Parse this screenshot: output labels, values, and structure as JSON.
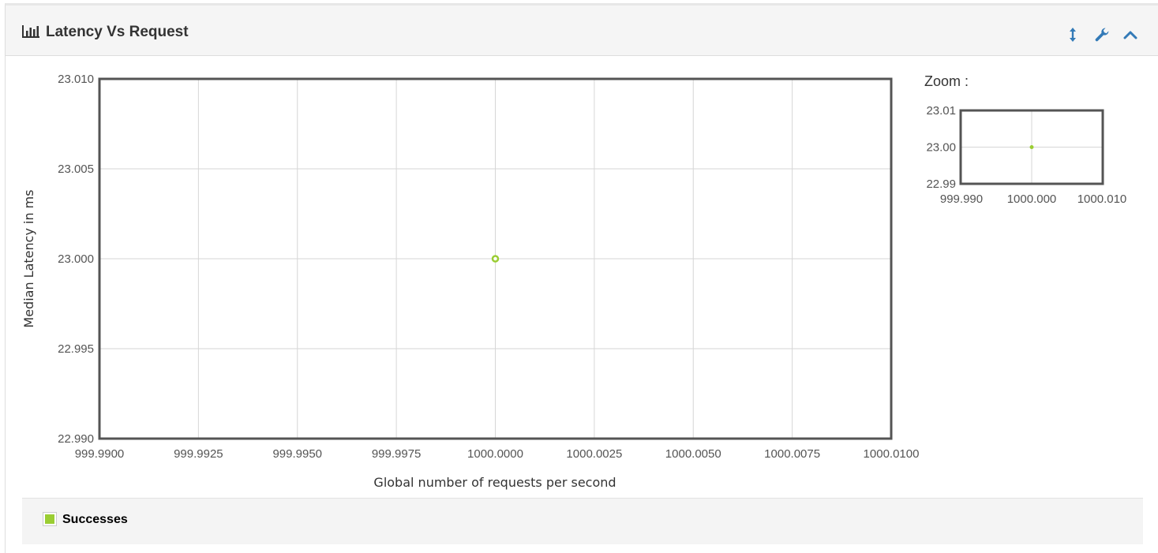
{
  "header": {
    "title": "Latency Vs Request",
    "title_icon": "bar-chart-icon",
    "tools": [
      {
        "icon": "resize-vertical-icon"
      },
      {
        "icon": "wrench-icon"
      },
      {
        "icon": "chevron-up-icon"
      }
    ],
    "tool_color": "#337ab7"
  },
  "zoom": {
    "label": "Zoom :",
    "x_ticks": [
      "999.990",
      "1000.000",
      "1000.010"
    ],
    "y_ticks": [
      "23.01",
      "23.00",
      "22.99"
    ],
    "xlim": [
      999.99,
      1000.01
    ],
    "ylim": [
      22.99,
      23.01
    ]
  },
  "chart_data": {
    "type": "scatter",
    "title": "Latency Vs Request",
    "xlabel": "Global number of requests per second",
    "ylabel": "Median Latency in ms",
    "xlim": [
      999.99,
      1000.01
    ],
    "ylim": [
      22.99,
      23.01
    ],
    "x_ticks": [
      "999.9900",
      "999.9925",
      "999.9950",
      "999.9975",
      "1000.0000",
      "1000.0025",
      "1000.0050",
      "1000.0075",
      "1000.0100"
    ],
    "y_ticks": [
      "23.010",
      "23.005",
      "23.000",
      "22.995",
      "22.990"
    ],
    "grid": true,
    "legend_position": "bottom",
    "series": [
      {
        "name": "Successes",
        "color": "#9ACD32",
        "points": [
          {
            "x": 1000.0,
            "y": 23.0
          }
        ]
      }
    ]
  }
}
